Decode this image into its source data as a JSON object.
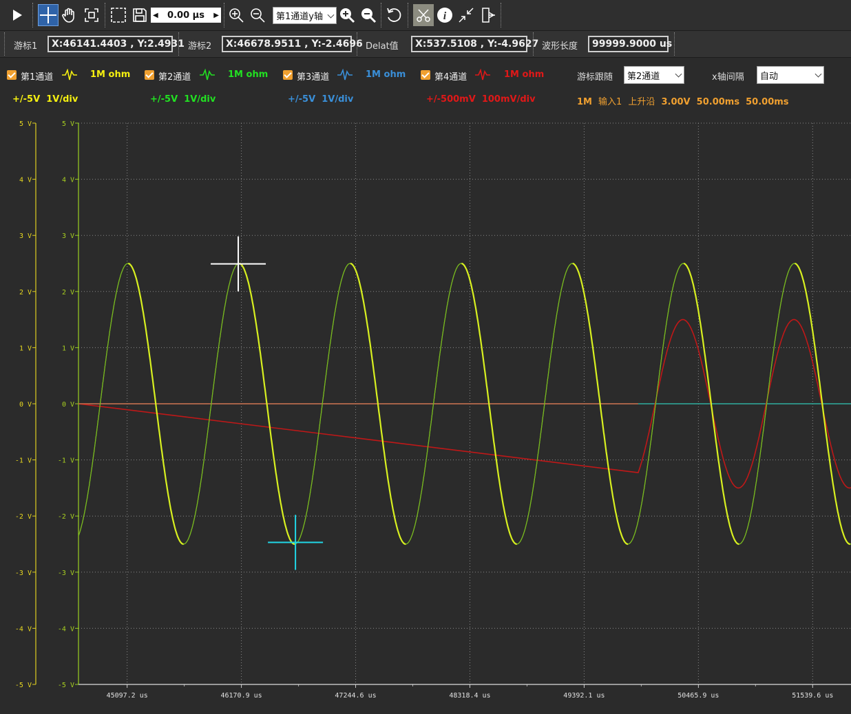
{
  "toolbar": {
    "time_offset": "0.00 μs",
    "yaxis_select": "第1通道y轴",
    "buttons": [
      "play-icon",
      "crosshair-icon",
      "hand-icon",
      "fit-icon",
      "select-box-icon",
      "save-icon",
      "zoom-in-icon",
      "zoom-out-icon",
      "zoom-in-y-icon",
      "zoom-out-y-icon",
      "reset-icon",
      "scissors-icon",
      "info-icon",
      "shrink-icon",
      "exit-icon"
    ]
  },
  "cursors": {
    "cursor1_label": "游标1",
    "cursor1_value": "X:46141.4403 , Y:2.4931",
    "cursor2_label": "游标2",
    "cursor2_value": "X:46678.9511 , Y:-2.4696",
    "delta_label": "Delat值",
    "delta_value": "X:537.5108 , Y:-4.9627",
    "length_label": "波形长度",
    "length_value": "99999.9000 us"
  },
  "channels": [
    {
      "name": "第1通道",
      "impedance": "1M ohm",
      "range": "+/-5V",
      "scale": "1V/div",
      "color": "#f5f010"
    },
    {
      "name": "第2通道",
      "impedance": "1M ohm",
      "range": "+/-5V",
      "scale": "1V/div",
      "color": "#22e022"
    },
    {
      "name": "第3通道",
      "impedance": "1M ohm",
      "range": "+/-5V",
      "scale": "1V/div",
      "color": "#3a8fd8"
    },
    {
      "name": "第4通道",
      "impedance": "1M ohm",
      "range": "+/-500mV",
      "scale": "100mV/div",
      "color": "#e01818"
    }
  ],
  "cursor_follow": {
    "label": "游标跟随",
    "value": "第2通道"
  },
  "x_interval": {
    "label": "x轴间隔",
    "value": "自动"
  },
  "trigger": {
    "impedance": "1M",
    "input": "输入1",
    "edge": "上升沿",
    "level": "3.00V",
    "time1": "50.00ms",
    "time2": "50.00ms"
  },
  "chart_data": {
    "type": "line",
    "ylim": [
      -5,
      5
    ],
    "yticks": [
      "5 V",
      "4 V",
      "3 V",
      "2 V",
      "1 V",
      "0 V",
      "-1 V",
      "-2 V",
      "-3 V",
      "-4 V",
      "-5 V"
    ],
    "xticks": [
      "45097.2 us",
      "46170.9 us",
      "47244.6 us",
      "48318.4 us",
      "49392.1 us",
      "50465.9 us",
      "51539.6 us"
    ],
    "xtick_values": [
      45097.2,
      46170.9,
      47244.6,
      48318.4,
      49392.1,
      50465.9,
      51539.6
    ],
    "xlim": [
      44640,
      51900
    ],
    "series": [
      {
        "name": "第1通道",
        "color": "#d8f020",
        "amplitude": 2.5,
        "period_us": 1044,
        "peak_at_us": 45105,
        "line_width": 2.2
      },
      {
        "name": "第2通道",
        "color": "#78b820",
        "amplitude": 2.5,
        "period_us": 1044,
        "peak_at_us": 45105,
        "line_width": 1.2
      },
      {
        "name": "第3通道",
        "color": "#2fb0a0",
        "flat": 0
      },
      {
        "name": "第4通道",
        "color": "#c01818",
        "amplitude": 1.5,
        "period_us": 1044,
        "peak_at_us": 50320,
        "start_us": 49900
      }
    ],
    "cursor1": {
      "x": 46141.4403,
      "y": 2.4931,
      "color": "#ffffff"
    },
    "cursor2": {
      "x": 46678.9511,
      "y": -2.4696,
      "color": "#20d8e8"
    }
  }
}
